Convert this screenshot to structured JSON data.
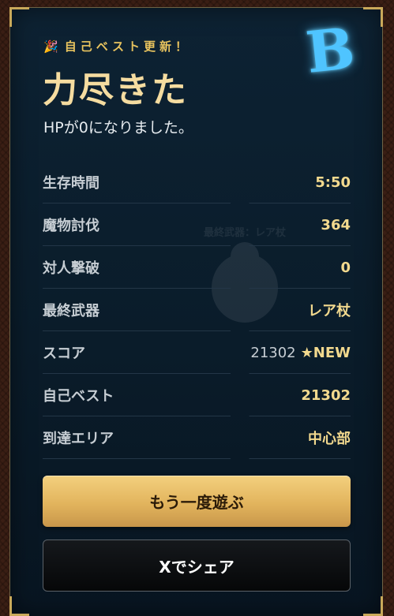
{
  "colors": {
    "accent_gold": "#e8c35e",
    "title": "#f5dca0",
    "rank": "#4fc4ff",
    "panel_bg": "#0c1f2e"
  },
  "header": {
    "badge_icon": "party-popper-icon",
    "badge_text": "自己ベスト更新！",
    "rank": "B",
    "title": "力尽きた",
    "subtitle": "HPが0になりました。"
  },
  "stats": [
    {
      "label": "生存時間",
      "value": "5:50"
    },
    {
      "label": "魔物討伐",
      "value": "364"
    },
    {
      "label": "対人撃破",
      "value": "0"
    },
    {
      "label": "最終武器",
      "value": "レア杖"
    },
    {
      "label": "スコア",
      "value_plain": "21302",
      "value": "★NEW"
    },
    {
      "label": "自己ベスト",
      "value": "21302"
    },
    {
      "label": "到達エリア",
      "value": "中心部"
    }
  ],
  "watermark": {
    "text": "最終武器：レア杖"
  },
  "buttons": {
    "play_again": "もう一度遊ぶ",
    "share": "Xでシェア"
  }
}
